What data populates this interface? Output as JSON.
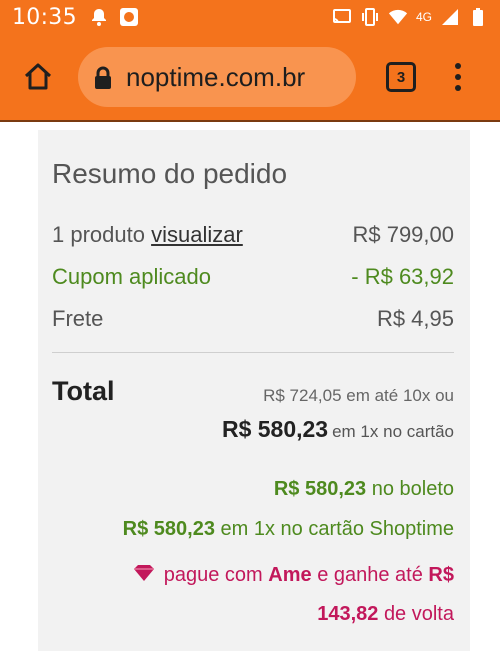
{
  "status_bar": {
    "time": "10:35",
    "network": "4G",
    "icons": [
      "notification-bell-icon",
      "app-notification-icon",
      "cast-icon",
      "vibrate-icon",
      "wifi-icon",
      "signal-icon",
      "battery-icon"
    ]
  },
  "browser": {
    "url": "noptime.com.br",
    "tab_count": "3",
    "accent": "#f4731c"
  },
  "summary": {
    "title": "Resumo do pedido",
    "product_count": "1 produto",
    "view_link": "visualizar",
    "product_price": "R$ 799,00",
    "coupon_label": "Cupom aplicado",
    "coupon_value": "- R$ 63,92",
    "shipping_label": "Frete",
    "shipping_value": "R$ 4,95",
    "total_label": "Total",
    "installments": "R$ 724,05 em até 10x ou",
    "card_price": "R$ 580,23",
    "card_suffix": "em 1x no cartão",
    "boleto_price": "R$ 580,23",
    "boleto_suffix": "no boleto",
    "shoptime_price": "R$ 580,23",
    "shoptime_suffix": "em 1x no cartão Shoptime",
    "ame_prefix": "pague com",
    "ame_brand": "Ame",
    "ame_middle": "e ganhe até",
    "ame_amount": "R$ 143,82",
    "ame_suffix": "de volta",
    "green": "#4e8a1f",
    "pink": "#c2185b"
  }
}
